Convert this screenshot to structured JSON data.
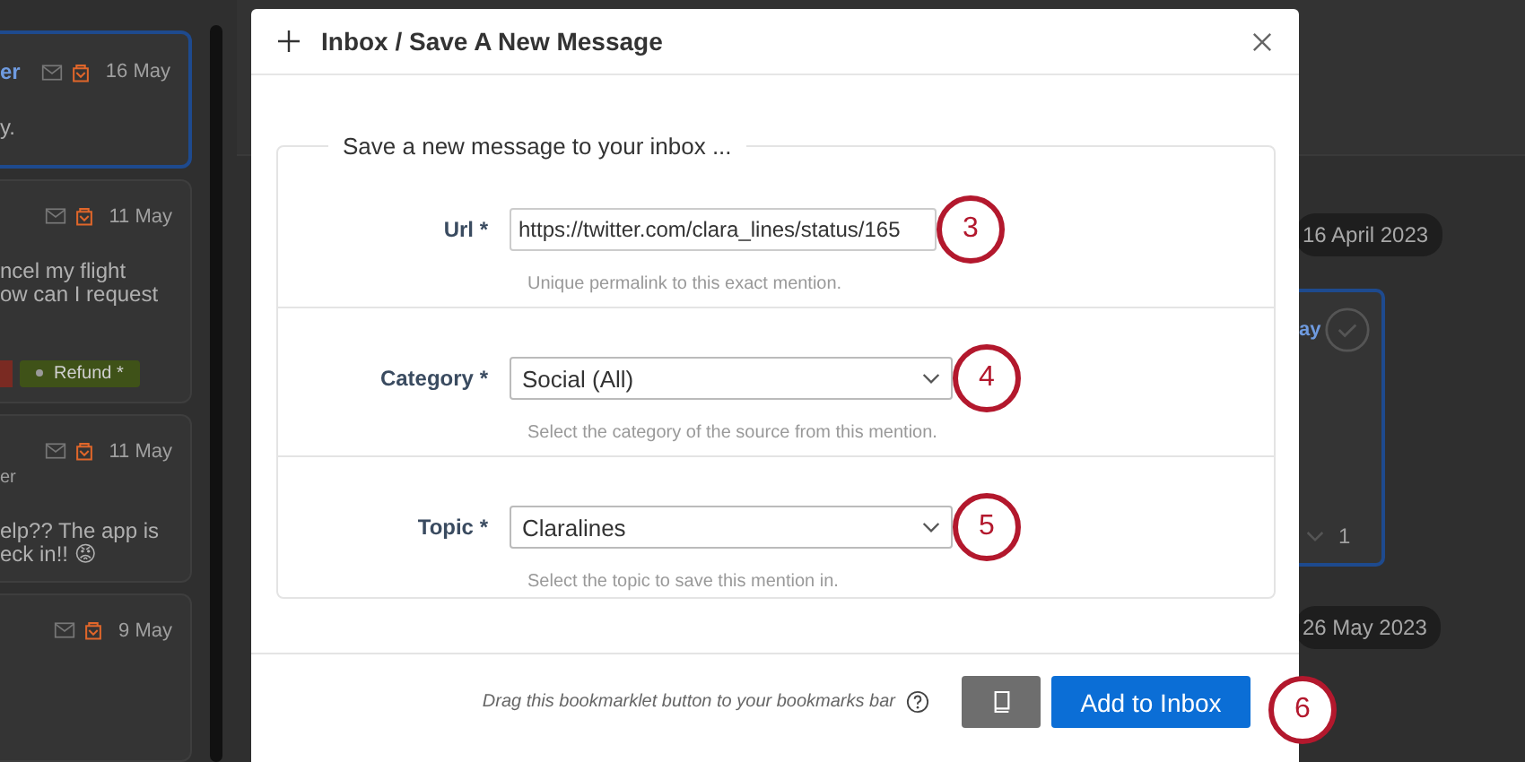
{
  "background": {
    "messages": [
      {
        "sender": "er",
        "date": "16 May",
        "lines": [
          "y."
        ],
        "selected": true
      },
      {
        "date": "11 May",
        "lines": [
          "ncel my flight",
          "ow can I request"
        ],
        "tags": [
          {
            "label": "Refund *",
            "color": "#3f5218"
          }
        ],
        "selected": false
      },
      {
        "date": "11 May",
        "subtitle": "er",
        "lines": [
          "elp?? The app is",
          "eck in!! 😡"
        ],
        "selected": false
      },
      {
        "date": "9 May",
        "selected": false
      }
    ],
    "timeline": {
      "first_date": "16 April 2023",
      "card": {
        "author": "ay",
        "count": "1"
      },
      "second_date": "26 May 2023"
    }
  },
  "modal": {
    "title": "Inbox / Save A New Message",
    "legend": "Save a new message to your inbox ...",
    "fields": [
      {
        "kind": "text",
        "label": "Url *",
        "value": "https://twitter.com/clara_lines/status/165",
        "help": "Unique permalink to this exact mention.",
        "marker": "3"
      },
      {
        "kind": "select",
        "label": "Category *",
        "value": "Social (All)",
        "help": "Select the category of the source from this mention.",
        "marker": "4"
      },
      {
        "kind": "select",
        "label": "Topic *",
        "value": "Claralines",
        "help": "Select the topic to save this mention in.",
        "marker": "5"
      }
    ],
    "footer": {
      "hint": "Drag this bookmarklet button to your bookmarks bar",
      "submit": "Add to Inbox",
      "marker": "6"
    }
  }
}
